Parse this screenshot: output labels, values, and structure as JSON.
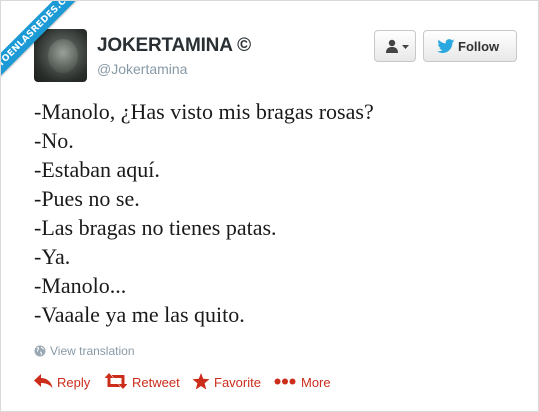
{
  "watermark": {
    "text": "VISTOENLASREDES.COM"
  },
  "profile": {
    "name": "JOKERTAMINA ©",
    "handle": "@Jokertamina"
  },
  "buttons": {
    "follow_label": "Follow"
  },
  "tweet": {
    "lines": [
      "-Manolo, ¿Has visto mis bragas rosas?",
      "-No.",
      "-Estaban aquí.",
      "-Pues no se.",
      "-Las bragas no tienes patas.",
      "-Ya.",
      "-Manolo...",
      "-Vaaale ya me las quito."
    ]
  },
  "translation": {
    "label": "View translation"
  },
  "actions": {
    "reply": "Reply",
    "retweet": "Retweet",
    "favorite": "Favorite",
    "more": "More"
  },
  "colors": {
    "action_red": "#cc2d1b",
    "follow_bird_blue": "#2aa9e0",
    "ribbon_blue": "#1b9ad6",
    "muted_gray": "#8899a6"
  }
}
